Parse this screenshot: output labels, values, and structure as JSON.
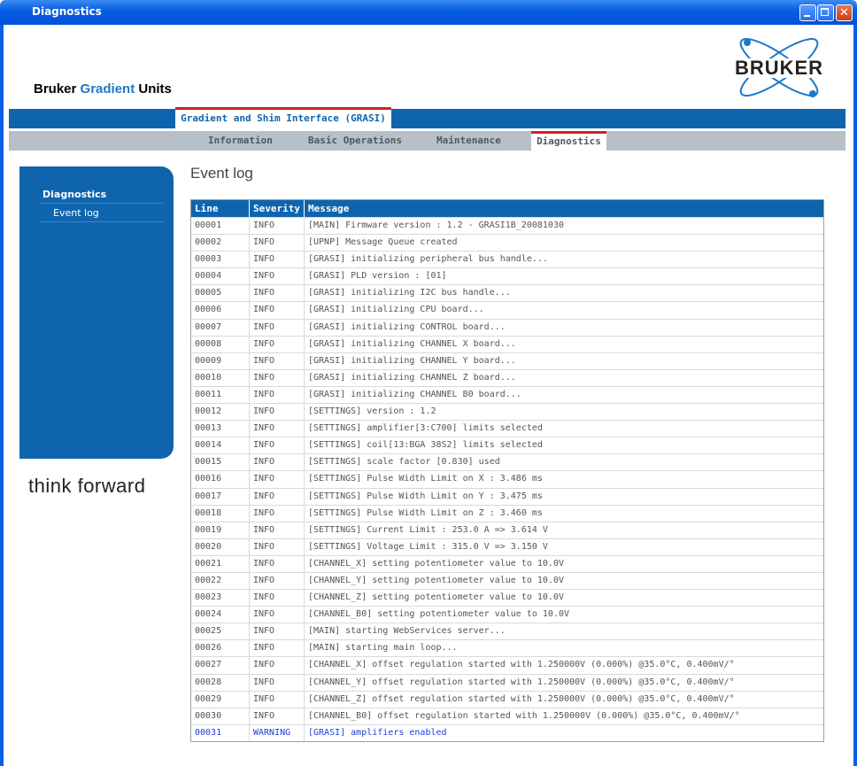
{
  "window": {
    "title": "Diagnostics"
  },
  "header": {
    "brand_prefix": "Bruker",
    "brand_accent": "Gradient",
    "brand_suffix": "Units",
    "logo_text": "BRUKER"
  },
  "product_tab": "Gradient and Shim Interface (GRASI)",
  "nav": [
    "Information",
    "Basic Operations",
    "Maintenance",
    "Diagnostics"
  ],
  "nav_active": "Diagnostics",
  "sidebar": {
    "heading": "Diagnostics",
    "items": [
      "Event log"
    ]
  },
  "tagline": "think forward",
  "page_title": "Event log",
  "log": {
    "columns": [
      "Line",
      "Severity",
      "Message"
    ],
    "rows": [
      [
        "00001",
        "INFO",
        "[MAIN] Firmware version : 1.2 - GRASI1B_20081030"
      ],
      [
        "00002",
        "INFO",
        "[UPNP] Message Queue created"
      ],
      [
        "00003",
        "INFO",
        "[GRASI] initializing peripheral bus handle..."
      ],
      [
        "00004",
        "INFO",
        "[GRASI] PLD version : [01]"
      ],
      [
        "00005",
        "INFO",
        "[GRASI] initializing I2C bus handle..."
      ],
      [
        "00006",
        "INFO",
        "[GRASI] initializing CPU board..."
      ],
      [
        "00007",
        "INFO",
        "[GRASI] initializing CONTROL board..."
      ],
      [
        "00008",
        "INFO",
        "[GRASI] initializing CHANNEL X board..."
      ],
      [
        "00009",
        "INFO",
        "[GRASI] initializing CHANNEL Y board..."
      ],
      [
        "00010",
        "INFO",
        "[GRASI] initializing CHANNEL Z board..."
      ],
      [
        "00011",
        "INFO",
        "[GRASI] initializing CHANNEL B0 board..."
      ],
      [
        "00012",
        "INFO",
        "[SETTINGS] version : 1.2"
      ],
      [
        "00013",
        "INFO",
        "[SETTINGS] amplifier[3:C700] limits selected"
      ],
      [
        "00014",
        "INFO",
        "[SETTINGS] coil[13:BGA 38S2] limits selected"
      ],
      [
        "00015",
        "INFO",
        "[SETTINGS] scale factor [0.830] used"
      ],
      [
        "00016",
        "INFO",
        "[SETTINGS] Pulse Width Limit on X : 3.486 ms"
      ],
      [
        "00017",
        "INFO",
        "[SETTINGS] Pulse Width Limit on Y : 3.475 ms"
      ],
      [
        "00018",
        "INFO",
        "[SETTINGS] Pulse Width Limit on Z : 3.460 ms"
      ],
      [
        "00019",
        "INFO",
        "[SETTINGS] Current Limit : 253.0 A => 3.614 V"
      ],
      [
        "00020",
        "INFO",
        "[SETTINGS] Voltage Limit : 315.0 V => 3.150 V"
      ],
      [
        "00021",
        "INFO",
        "[CHANNEL_X] setting potentiometer value to 10.0V"
      ],
      [
        "00022",
        "INFO",
        "[CHANNEL_Y] setting potentiometer value to 10.0V"
      ],
      [
        "00023",
        "INFO",
        "[CHANNEL_Z] setting potentiometer value to 10.0V"
      ],
      [
        "00024",
        "INFO",
        "[CHANNEL_B0] setting potentiometer value to 10.0V"
      ],
      [
        "00025",
        "INFO",
        "[MAIN] starting WebServices server..."
      ],
      [
        "00026",
        "INFO",
        "[MAIN] starting main loop..."
      ],
      [
        "00027",
        "INFO",
        "[CHANNEL_X] offset regulation started with 1.250000V (0.000%) @35.0°C, 0.400mV/°"
      ],
      [
        "00028",
        "INFO",
        "[CHANNEL_Y] offset regulation started with 1.250000V (0.000%) @35.0°C, 0.400mV/°"
      ],
      [
        "00029",
        "INFO",
        "[CHANNEL_Z] offset regulation started with 1.250000V (0.000%) @35.0°C, 0.400mV/°"
      ],
      [
        "00030",
        "INFO",
        "[CHANNEL_B0] offset regulation started with 1.250000V (0.000%) @35.0°C, 0.400mV/°"
      ],
      [
        "00031",
        "WARNING",
        "[GRASI] amplifiers enabled"
      ]
    ]
  },
  "colors": {
    "brand_blue": "#0f65ad",
    "accent_red": "#cc2228",
    "warning_text": "#1f3fd6"
  }
}
